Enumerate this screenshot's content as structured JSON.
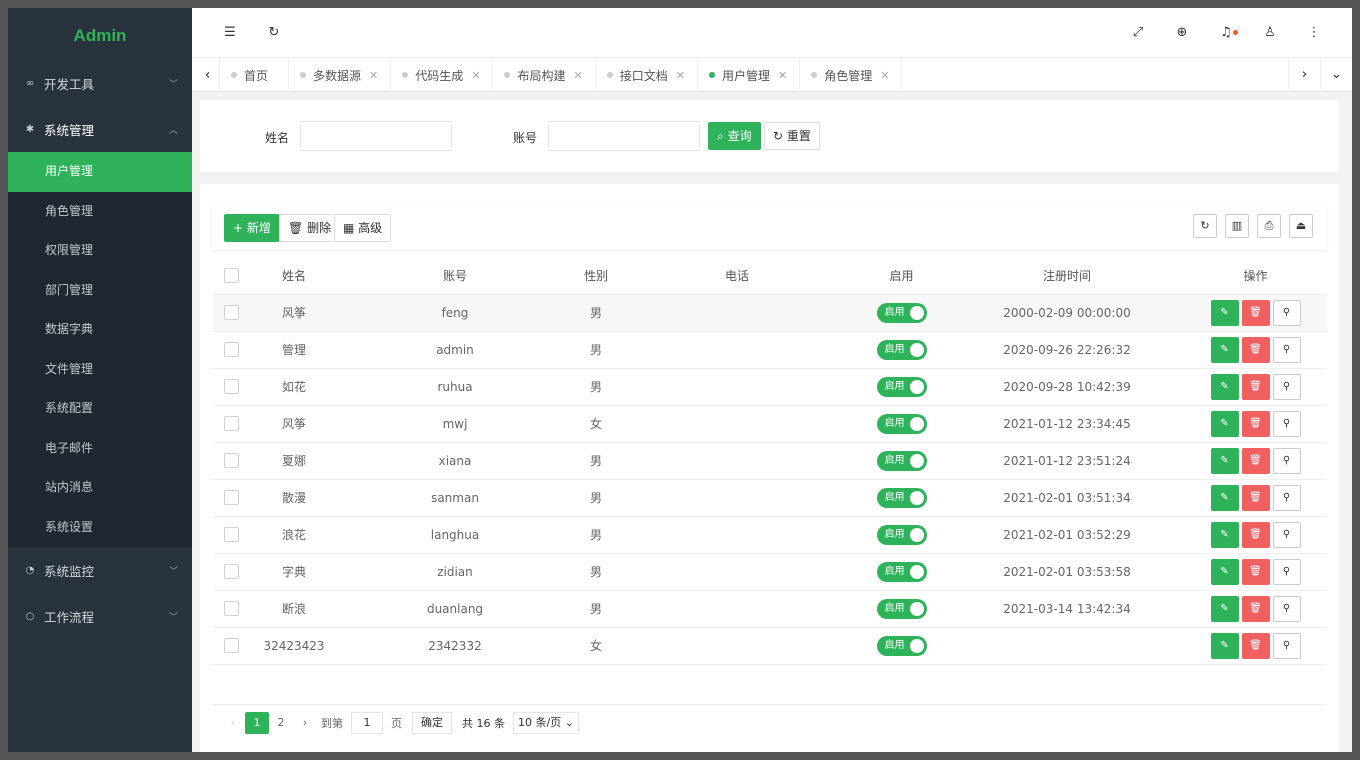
{
  "app": {
    "logo": "Admin"
  },
  "sidebar": {
    "groups": [
      {
        "label": "开发工具",
        "expanded": false
      },
      {
        "label": "系统管理",
        "expanded": true
      },
      {
        "label": "系统监控",
        "expanded": false
      },
      {
        "label": "工作流程",
        "expanded": false
      }
    ],
    "sub_items": [
      "用户管理",
      "角色管理",
      "权限管理",
      "部门管理",
      "数据字典",
      "文件管理",
      "系统配置",
      "电子邮件",
      "站内消息",
      "系统设置"
    ],
    "active_sub": "用户管理"
  },
  "tabs": [
    "首页",
    "多数据源",
    "代码生成",
    "布局构建",
    "接口文档",
    "用户管理",
    "角色管理"
  ],
  "active_tab": "用户管理",
  "search": {
    "name_label": "姓名",
    "account_label": "账号",
    "query_label": "查询",
    "reset_label": "重置"
  },
  "toolbar": {
    "add_label": "新增",
    "delete_label": "删除",
    "advanced_label": "高级"
  },
  "table": {
    "columns": [
      "姓名",
      "账号",
      "性别",
      "电话",
      "启用",
      "注册时间",
      "操作"
    ],
    "switch_label": "启用",
    "rows": [
      {
        "name": "风筝",
        "account": "feng",
        "gender": "男",
        "phone": "",
        "registered": "2000-02-09 00:00:00"
      },
      {
        "name": "管理",
        "account": "admin",
        "gender": "男",
        "phone": "",
        "registered": "2020-09-26 22:26:32"
      },
      {
        "name": "如花",
        "account": "ruhua",
        "gender": "男",
        "phone": "",
        "registered": "2020-09-28 10:42:39"
      },
      {
        "name": "风筝",
        "account": "mwj",
        "gender": "女",
        "phone": "",
        "registered": "2021-01-12 23:34:45"
      },
      {
        "name": "夏娜",
        "account": "xiana",
        "gender": "男",
        "phone": "",
        "registered": "2021-01-12 23:51:24"
      },
      {
        "name": "散漫",
        "account": "sanman",
        "gender": "男",
        "phone": "",
        "registered": "2021-02-01 03:51:34"
      },
      {
        "name": "浪花",
        "account": "langhua",
        "gender": "男",
        "phone": "",
        "registered": "2021-02-01 03:52:29"
      },
      {
        "name": "字典",
        "account": "zidian",
        "gender": "男",
        "phone": "",
        "registered": "2021-02-01 03:53:58"
      },
      {
        "name": "断浪",
        "account": "duanlang",
        "gender": "男",
        "phone": "",
        "registered": "2021-03-14 13:42:34"
      },
      {
        "name": "32423423",
        "account": "2342332",
        "gender": "女",
        "phone": "",
        "registered": ""
      }
    ]
  },
  "pagination": {
    "pages": [
      "1",
      "2"
    ],
    "current": "1",
    "goto_label": "到第",
    "goto_value": "1",
    "page_unit": "页",
    "confirm_label": "确定",
    "total_label": "共 16 条",
    "page_size": "10 条/页"
  },
  "colors": {
    "accent": "#2eb35a",
    "danger": "#f06060",
    "sidebar": "#28333e",
    "notify": "#f05a24"
  }
}
